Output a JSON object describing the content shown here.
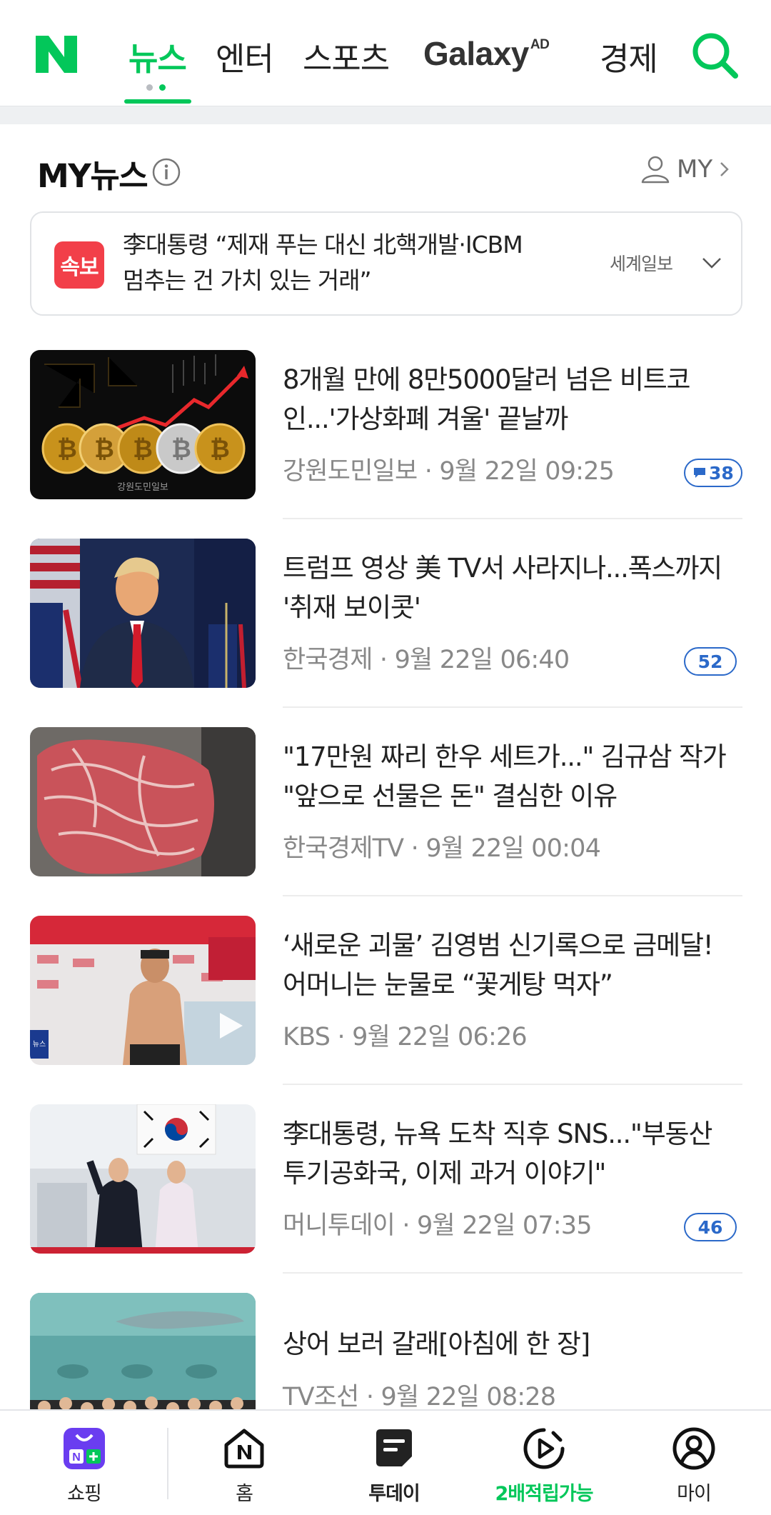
{
  "nav": {
    "tabs": [
      {
        "label": "뉴스",
        "active": true
      },
      {
        "label": "엔터"
      },
      {
        "label": "스포츠"
      },
      {
        "label": "Galaxy",
        "badge": "AD"
      },
      {
        "label": "경제"
      }
    ],
    "colors": {
      "brand": "#03c75a"
    }
  },
  "my_news": {
    "title": "MY뉴스",
    "my_link": "MY"
  },
  "breaking": {
    "badge": "속보",
    "title": "李대통령 “제재 푸는 대신 北핵개발·ICBM 멈추는 건 가치 있는 거래”",
    "source": "세계일보",
    "badge_color": "#f23f49"
  },
  "news": [
    {
      "title": "8개월 만에 8만5000달러 넘은 비트코인...'가상화폐 겨울' 끝날까",
      "source": "강원도민일보",
      "time": "9월 22일 09:25",
      "comments": "38",
      "thumb_caption": "강원도민일보"
    },
    {
      "title": "트럼프 영상 美 TV서 사라지나...폭스까지 '취재 보이콧'",
      "source": "한국경제",
      "time": "9월 22일 06:40",
      "comments": "52"
    },
    {
      "title": "\"17만원 짜리 한우 세트가...\" 김규삼 작가 \"앞으로 선물은 돈\" 결심한 이유",
      "source": "한국경제TV",
      "time": "9월 22일 00:04"
    },
    {
      "title": "‘새로운 괴물’ 김영범 신기록으로 금메달! 어머니는 눈물로 “꽃게탕 먹자”",
      "source": "KBS",
      "time": "9월 22일 06:26",
      "thumb_caption": "뉴스"
    },
    {
      "title": "李대통령, 뉴욕 도착 직후 SNS...\"부동산 투기공화국, 이제 과거 이야기\"",
      "source": "머니투데이",
      "time": "9월 22일 07:35",
      "comments": "46"
    },
    {
      "title": "상어 보러 갈래[아침에 한 장]",
      "source": "TV조선",
      "time": "9월 22일 08:28"
    }
  ],
  "bottom_tabs": [
    {
      "label": "쇼핑",
      "icon": "shopping-bag-icon"
    },
    {
      "label": "홈",
      "icon": "home-icon"
    },
    {
      "label": "투데이",
      "icon": "today-icon"
    },
    {
      "label": "2배적립가능",
      "icon": "clip-play-icon"
    },
    {
      "label": "마이",
      "icon": "user-icon"
    }
  ]
}
